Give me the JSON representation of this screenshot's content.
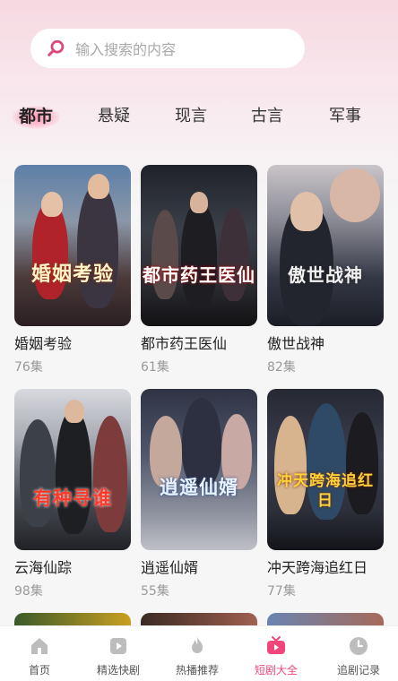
{
  "search": {
    "placeholder": "输入搜索的内容"
  },
  "categories": [
    {
      "label": "都市",
      "active": true
    },
    {
      "label": "悬疑",
      "active": false
    },
    {
      "label": "现言",
      "active": false
    },
    {
      "label": "古言",
      "active": false
    },
    {
      "label": "军事",
      "active": false
    }
  ],
  "dramas": [
    {
      "title": "婚姻考验",
      "episodes": "76集",
      "poster_text": "婚姻考验"
    },
    {
      "title": "都市药王医仙",
      "episodes": "61集",
      "poster_text": "都市药王医仙"
    },
    {
      "title": "傲世战神",
      "episodes": "82集",
      "poster_text": "傲世战神"
    },
    {
      "title": "云海仙踪",
      "episodes": "98集",
      "poster_text": "有种寻谁"
    },
    {
      "title": "逍遥仙婿",
      "episodes": "55集",
      "poster_text": "逍遥仙婿"
    },
    {
      "title": "冲天跨海追红日",
      "episodes": "77集",
      "poster_text": "冲天跨海追红日"
    }
  ],
  "bottom_nav": [
    {
      "label": "首页",
      "icon": "home-icon",
      "active": false
    },
    {
      "label": "精选快剧",
      "icon": "play-icon",
      "active": false
    },
    {
      "label": "热播推荐",
      "icon": "flame-icon",
      "active": false
    },
    {
      "label": "短剧大全",
      "icon": "tv-icon",
      "active": true
    },
    {
      "label": "追剧记录",
      "icon": "clock-icon",
      "active": false
    }
  ],
  "colors": {
    "accent": "#f0467a",
    "muted": "#9a9a9a"
  }
}
